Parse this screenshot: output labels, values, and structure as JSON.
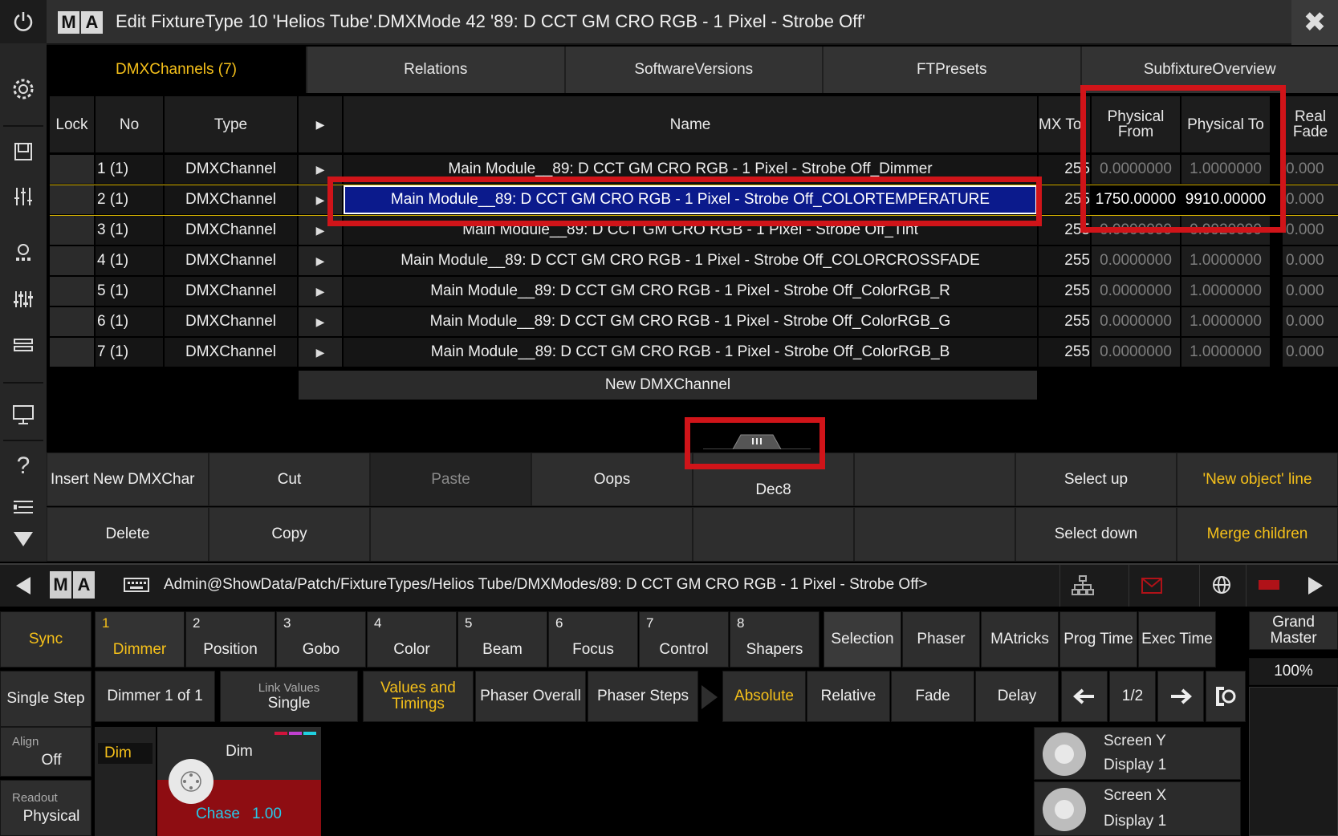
{
  "title": "Edit FixtureType 10 'Helios Tube'.DMXMode 42 '89: D CCT GM CRO RGB -  1 Pixel - Strobe Off'",
  "logo": [
    "M",
    "A"
  ],
  "close_label": "✖",
  "tabs": [
    {
      "label": "DMXChannels (7)"
    },
    {
      "label": "Relations"
    },
    {
      "label": "SoftwareVersions"
    },
    {
      "label": "FTPresets"
    },
    {
      "label": "SubfixtureOverview"
    }
  ],
  "headers": {
    "lock": "Lock",
    "no": "No",
    "type": "Type",
    "arrow": "▶",
    "name": "Name",
    "mx_to": "MX To",
    "phys_from": "Physical From",
    "phys_to": "Physical To",
    "real_fade": "Real Fade"
  },
  "rows": [
    {
      "no": "1 (1)",
      "type": "DMXChannel",
      "arrow": "▶",
      "name": "Main Module__89: D CCT GM CRO RGB -  1 Pixel - Strobe Off_Dimmer",
      "mx": "255",
      "pfrom": "0.0000000",
      "pto": "1.0000000",
      "rf": "0.000"
    },
    {
      "no": "2 (1)",
      "type": "DMXChannel",
      "arrow": "▶",
      "name": "Main Module__89: D CCT GM CRO RGB -  1 Pixel - Strobe Off_COLORTEMPERATURE",
      "mx": "255",
      "pfrom": "1750.00000",
      "pto": "9910.00000",
      "rf": "0.000"
    },
    {
      "no": "3 (1)",
      "type": "DMXChannel",
      "arrow": "▶",
      "name": "Main Module__89: D CCT GM CRO RGB -  1 Pixel - Strobe Off_Tint",
      "mx": "255",
      "pfrom": "0.0000000",
      "pto": "0.9920000",
      "rf": "0.000"
    },
    {
      "no": "4 (1)",
      "type": "DMXChannel",
      "arrow": "▶",
      "name": "Main Module__89: D CCT GM CRO RGB -  1 Pixel - Strobe Off_COLORCROSSFADE",
      "mx": "255",
      "pfrom": "0.0000000",
      "pto": "1.0000000",
      "rf": "0.000"
    },
    {
      "no": "5 (1)",
      "type": "DMXChannel",
      "arrow": "▶",
      "name": "Main Module__89: D CCT GM CRO RGB -  1 Pixel - Strobe Off_ColorRGB_R",
      "mx": "255",
      "pfrom": "0.0000000",
      "pto": "1.0000000",
      "rf": "0.000"
    },
    {
      "no": "6 (1)",
      "type": "DMXChannel",
      "arrow": "▶",
      "name": "Main Module__89: D CCT GM CRO RGB -  1 Pixel - Strobe Off_ColorRGB_G",
      "mx": "255",
      "pfrom": "0.0000000",
      "pto": "1.0000000",
      "rf": "0.000"
    },
    {
      "no": "7 (1)",
      "type": "DMXChannel",
      "arrow": "▶",
      "name": "Main Module__89: D CCT GM CRO RGB -  1 Pixel - Strobe Off_ColorRGB_B",
      "mx": "255",
      "pfrom": "0.0000000",
      "pto": "1.0000000",
      "rf": "0.000"
    }
  ],
  "new_dmx_label": "New DMXChannel",
  "cmds": {
    "insert": "Insert New DMXChar",
    "cut": "Cut",
    "paste": "Paste",
    "oops": "Oops",
    "dec8": "Dec8",
    "select_up": "Select up",
    "new_obj": "'New object' line",
    "delete": "Delete",
    "copy": "Copy",
    "select_down": "Select down",
    "merge": "Merge children"
  },
  "cmdline": {
    "logo": [
      "M",
      "A"
    ],
    "path": "Admin@ShowData/Patch/FixtureTypes/Helios Tube/DMXModes/89: D CCT GM CRO RGB -  1 Pixel - Strobe Off>"
  },
  "presets": [
    {
      "num": "1",
      "label": "Dimmer",
      "active": true
    },
    {
      "num": "2",
      "label": "Position"
    },
    {
      "num": "3",
      "label": "Gobo"
    },
    {
      "num": "4",
      "label": "Color"
    },
    {
      "num": "5",
      "label": "Beam"
    },
    {
      "num": "6",
      "label": "Focus"
    },
    {
      "num": "7",
      "label": "Control"
    },
    {
      "num": "8",
      "label": "Shapers"
    }
  ],
  "views": [
    "Selection",
    "Phaser",
    "MAtricks",
    "Prog Time",
    "Exec Time"
  ],
  "sync_label": "Sync",
  "grand_master": {
    "label": "Grand Master",
    "value": "100%"
  },
  "row2": {
    "single_step": "Single Step",
    "dimmer_of": "Dimmer 1 of 1",
    "link_caption": "Link Values",
    "link_value": "Single",
    "values_timings": "Values and Timings",
    "phaser_overall": "Phaser Overall",
    "phaser_steps": "Phaser Steps",
    "absolute": "Absolute",
    "relative": "Relative",
    "fade": "Fade",
    "delay": "Delay",
    "page": "1/2"
  },
  "align": {
    "caption": "Align",
    "value": "Off"
  },
  "readout": {
    "caption": "Readout",
    "value": "Physical"
  },
  "dim_tag": "Dim",
  "dim_tile": {
    "title": "Dim",
    "chase": "Chase",
    "chase_value": "1.00"
  },
  "encoders": [
    {
      "line1": "Screen Y",
      "line2": "Display 1"
    },
    {
      "line1": "Screen X",
      "line2": "Display 1"
    }
  ],
  "colors": {
    "accent": "#f5c01a",
    "highlight_row": "#0b1a8c",
    "redbox": "#d01419"
  }
}
